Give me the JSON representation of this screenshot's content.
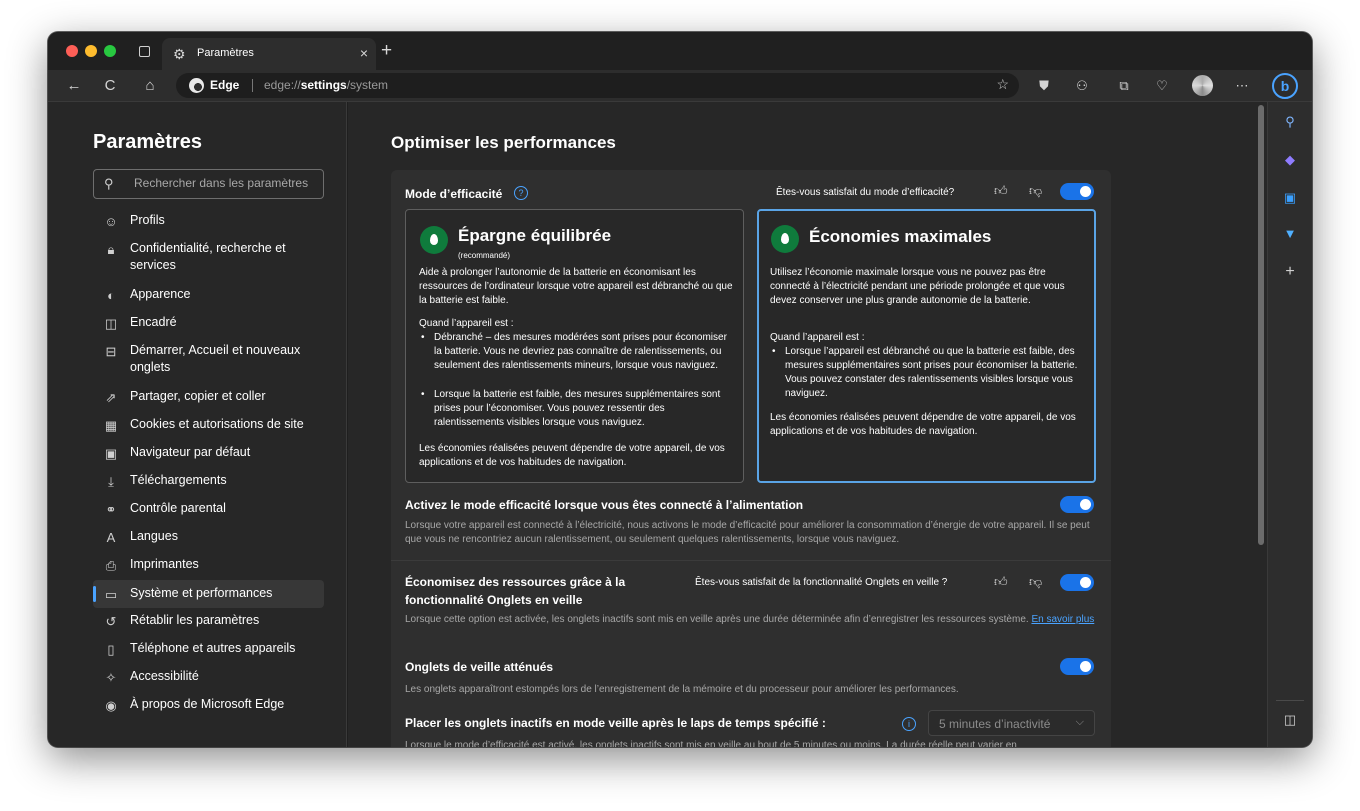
{
  "browser": {
    "tab": {
      "title": "Paramètres",
      "icon": "gear-icon",
      "close": "×"
    },
    "new_tab": "+",
    "nav_glyphs": {
      "back": "←",
      "refresh": "C",
      "home": "⌂",
      "more": "⋯"
    },
    "address": {
      "brand": "Edge",
      "url_prefix": "edge://",
      "url_bold": "settings",
      "url_suffix": "/system"
    },
    "sidebar_icons": [
      "search-icon",
      "tag-icon",
      "outlook-icon",
      "drop-icon",
      "plus-icon",
      "split-screen-icon",
      "gear-icon"
    ]
  },
  "nav": {
    "title": "Paramètres",
    "search_placeholder": "Rechercher dans les paramètres",
    "items": [
      {
        "label": "Profils",
        "icon": "profile-icon"
      },
      {
        "label": "Confidentialité, recherche et services",
        "icon": "lock-icon"
      },
      {
        "label": "Apparence",
        "icon": "palette-icon"
      },
      {
        "label": "Encadré",
        "icon": "sidebar-icon"
      },
      {
        "label": "Démarrer, Accueil et nouveaux onglets",
        "icon": "home-window-icon"
      },
      {
        "label": "Partager, copier et coller",
        "icon": "share-icon"
      },
      {
        "label": "Cookies et autorisations de site",
        "icon": "cookies-icon"
      },
      {
        "label": "Navigateur par défaut",
        "icon": "browser-icon"
      },
      {
        "label": "Téléchargements",
        "icon": "download-icon"
      },
      {
        "label": "Contrôle parental",
        "icon": "family-icon"
      },
      {
        "label": "Langues",
        "icon": "language-icon"
      },
      {
        "label": "Imprimantes",
        "icon": "printer-icon"
      },
      {
        "label": "Système et performances",
        "icon": "laptop-icon",
        "active": true
      },
      {
        "label": "Rétablir les paramètres",
        "icon": "reset-icon"
      },
      {
        "label": "Téléphone et autres appareils",
        "icon": "phone-icon"
      },
      {
        "label": "Accessibilité",
        "icon": "accessibility-icon"
      },
      {
        "label": "À propos de Microsoft Edge",
        "icon": "edge-logo-icon"
      }
    ]
  },
  "main": {
    "title": "Optimiser les performances",
    "efficiency": {
      "title": "Mode d’efficacité",
      "feedback_question": "Êtes-vous satisfait du mode d’efficacité?",
      "toggle_on": true
    },
    "cards": [
      {
        "title": "Épargne équilibrée",
        "subtitle": "(recommandé)",
        "intro": "Aide à prolonger l’autonomie de la batterie en économisant les ressources de l’ordinateur lorsque votre appareil est débranché ou que la batterie est faible.",
        "when": "Quand l’appareil est :",
        "bullets": [
          "Débranché – des mesures modérées sont prises pour économiser la batterie. Vous ne devriez pas connaître de ralentissements, ou seulement des ralentissements mineurs, lorsque vous naviguez.",
          "Lorsque la batterie est faible, des mesures supplémentaires sont prises pour l’économiser. Vous pouvez ressentir des ralentissements visibles lorsque vous naviguez."
        ],
        "footer": "Les économies réalisées peuvent dépendre de votre appareil, de vos applications et de vos habitudes de navigation.",
        "selected": false
      },
      {
        "title": "Économies maximales",
        "intro": "Utilisez l’économie maximale lorsque vous ne pouvez pas être connecté à l’électricité pendant une période prolongée et que vous devez conserver une plus grande autonomie de la batterie.",
        "when": "Quand l’appareil est :",
        "bullets": [
          "Lorsque l’appareil est débranché ou que la batterie est faible, des mesures supplémentaires sont prises pour économiser la batterie. Vous pouvez constater des ralentissements visibles lorsque vous naviguez."
        ],
        "footer": "Les économies réalisées peuvent dépendre de votre appareil, de vos applications et de vos habitudes de navigation.",
        "selected": true
      }
    ],
    "power_mode": {
      "title": "Activez le mode efficacité lorsque vous êtes connecté à l’alimentation",
      "desc": "Lorsque votre appareil est connecté à l’électricité, nous activons le mode d’efficacité pour améliorer la consommation d’énergie de votre appareil. Il se peut que vous ne rencontriez aucun ralentissement, ou seulement quelques ralentissements, lorsque vous naviguez.",
      "toggle_on": true
    },
    "sleeping_tabs": {
      "title_line1": "Économisez des ressources grâce à la",
      "title_line2": "fonctionnalité Onglets en veille",
      "feedback_question": "Êtes-vous satisfait de la fonctionnalité Onglets en veille ?",
      "desc": "Lorsque cette option est activée, les onglets inactifs sont mis en veille après une durée déterminée afin d’enregistrer les ressources système.",
      "learn_more": "En savoir plus",
      "toggle_on": true
    },
    "faded_tabs": {
      "title": "Onglets de veille atténués",
      "desc": "Les onglets apparaîtront estompés lors de l’enregistrement de la mémoire et du processeur pour améliorer les performances.",
      "toggle_on": true
    },
    "inactive_tabs": {
      "title": "Placer les onglets inactifs en mode veille après le laps de temps spécifié :",
      "select_value": "5 minutes d’inactivité",
      "desc": "Lorsque le mode d’efficacité est activé, les onglets inactifs sont mis en veille au bout de 5 minutes ou moins. La durée réelle peut varier en"
    }
  },
  "colors": {
    "accent": "#1a73e8",
    "link": "#4aa3ff",
    "selected_border": "#5aa4e6",
    "card_logo": "#0f7b3c"
  }
}
